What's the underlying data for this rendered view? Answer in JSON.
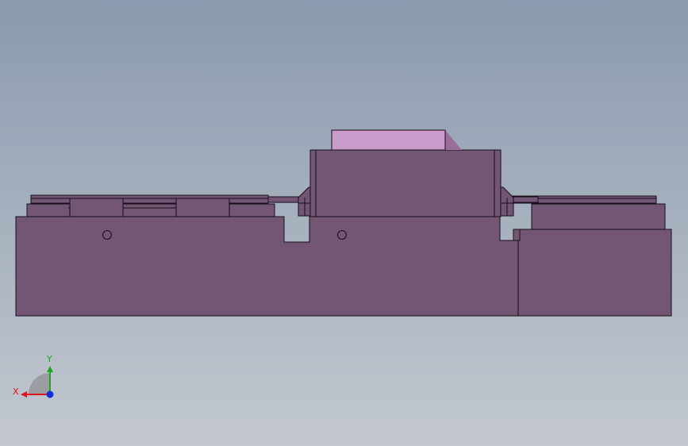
{
  "viewport": {
    "background_top": "#8a9aaf",
    "background_bottom": "#c3c8ce"
  },
  "model": {
    "body_color": "#735673",
    "edge_color": "#1a0d1a",
    "highlight_color": "#c99ccb",
    "shade_color": "#9b6d9a"
  },
  "triad": {
    "x_label": "X",
    "y_label": "Y",
    "x_color": "#e0141e",
    "y_color": "#1fa81f",
    "z_color": "#1030e0"
  }
}
